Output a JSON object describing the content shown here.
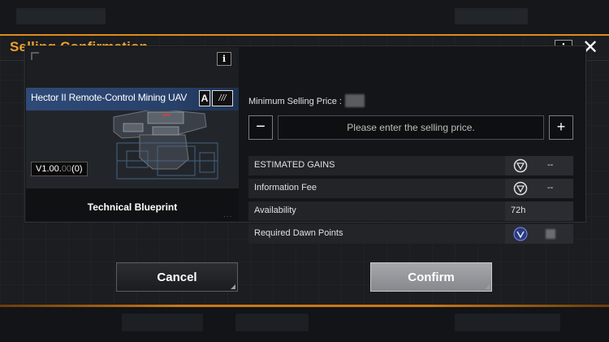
{
  "dialog": {
    "title": "Selling Confirmation",
    "info_icon": "info-icon",
    "close_icon": "close-icon",
    "accent_color": "#e08c1c"
  },
  "item_card": {
    "name": "Hector II Remote-Control Mining UAV",
    "grade": "A",
    "grade_stripes": "///",
    "price_prefix": "V1.00.",
    "price_dim": "00",
    "price_suffix": "(0)",
    "type": "Technical Blueprint",
    "info_icon": "info-icon",
    "more_icon": "..."
  },
  "selling": {
    "min_price_label": "Minimum Selling Price :",
    "minus_label": "−",
    "plus_label": "+",
    "input_placeholder": "Please enter the selling price.",
    "input_value": ""
  },
  "details": [
    {
      "label": "ESTIMATED GAINS",
      "icon": "currency-icon",
      "value": "--"
    },
    {
      "label": "Information Fee",
      "icon": "currency-icon",
      "value": "--"
    },
    {
      "label": "Availability",
      "value": "72h"
    },
    {
      "label": "Required Dawn Points",
      "icon": "dawn-points-icon"
    }
  ],
  "actions": {
    "cancel_label": "Cancel",
    "confirm_label": "Confirm"
  }
}
